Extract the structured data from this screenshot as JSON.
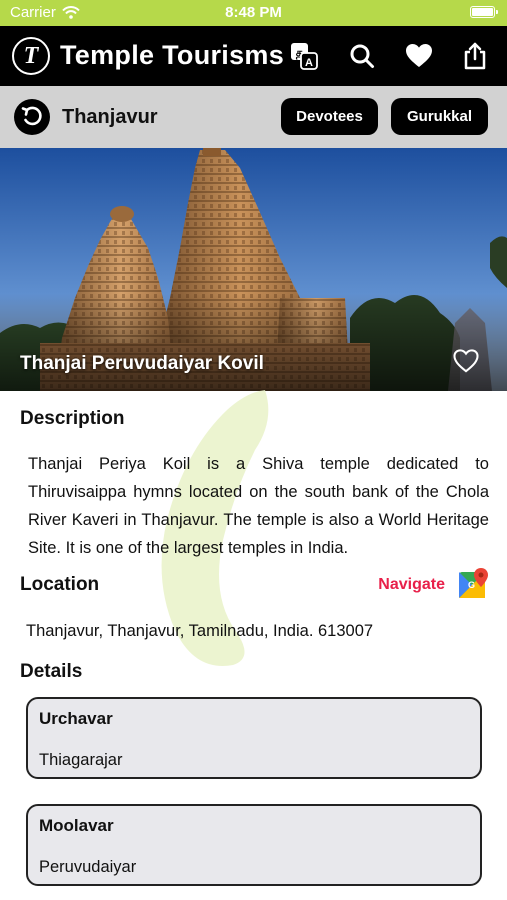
{
  "status_bar": {
    "carrier": "Carrier",
    "time": "8:48 PM"
  },
  "header": {
    "logo_letter": "T",
    "title": "Temple Tourisms",
    "icons": [
      "translate-icon",
      "search-icon",
      "heart-icon",
      "share-icon"
    ]
  },
  "subheader": {
    "place": "Thanjavur",
    "buttons": {
      "devotees": "Devotees",
      "gurukkal": "Gurukkal"
    }
  },
  "hero": {
    "title": "Thanjai Peruvudaiyar Kovil"
  },
  "description": {
    "title": "Description",
    "text": "Thanjai Periya Koil is a Shiva temple dedicated to Thiruvisaippa hymns located on the south bank of the Chola River Kaveri in Thanjavur. The temple is also a World Heritage Site. It is one of the largest temples in India."
  },
  "location": {
    "title": "Location",
    "navigate_label": "Navigate",
    "address": "Thanjavur, Thanjavur, Tamilnadu, India. 613007"
  },
  "details": {
    "title": "Details",
    "items": [
      {
        "label": "Urchavar",
        "value": "Thiagarajar"
      },
      {
        "label": "Moolavar",
        "value": "Peruvudaiyar"
      }
    ]
  },
  "colors": {
    "status_bar": "#b6d94a",
    "header": "#000000",
    "subheader": "#d2d2d2",
    "navigate": "#e8204a",
    "card_bg": "#e8e8ec"
  }
}
